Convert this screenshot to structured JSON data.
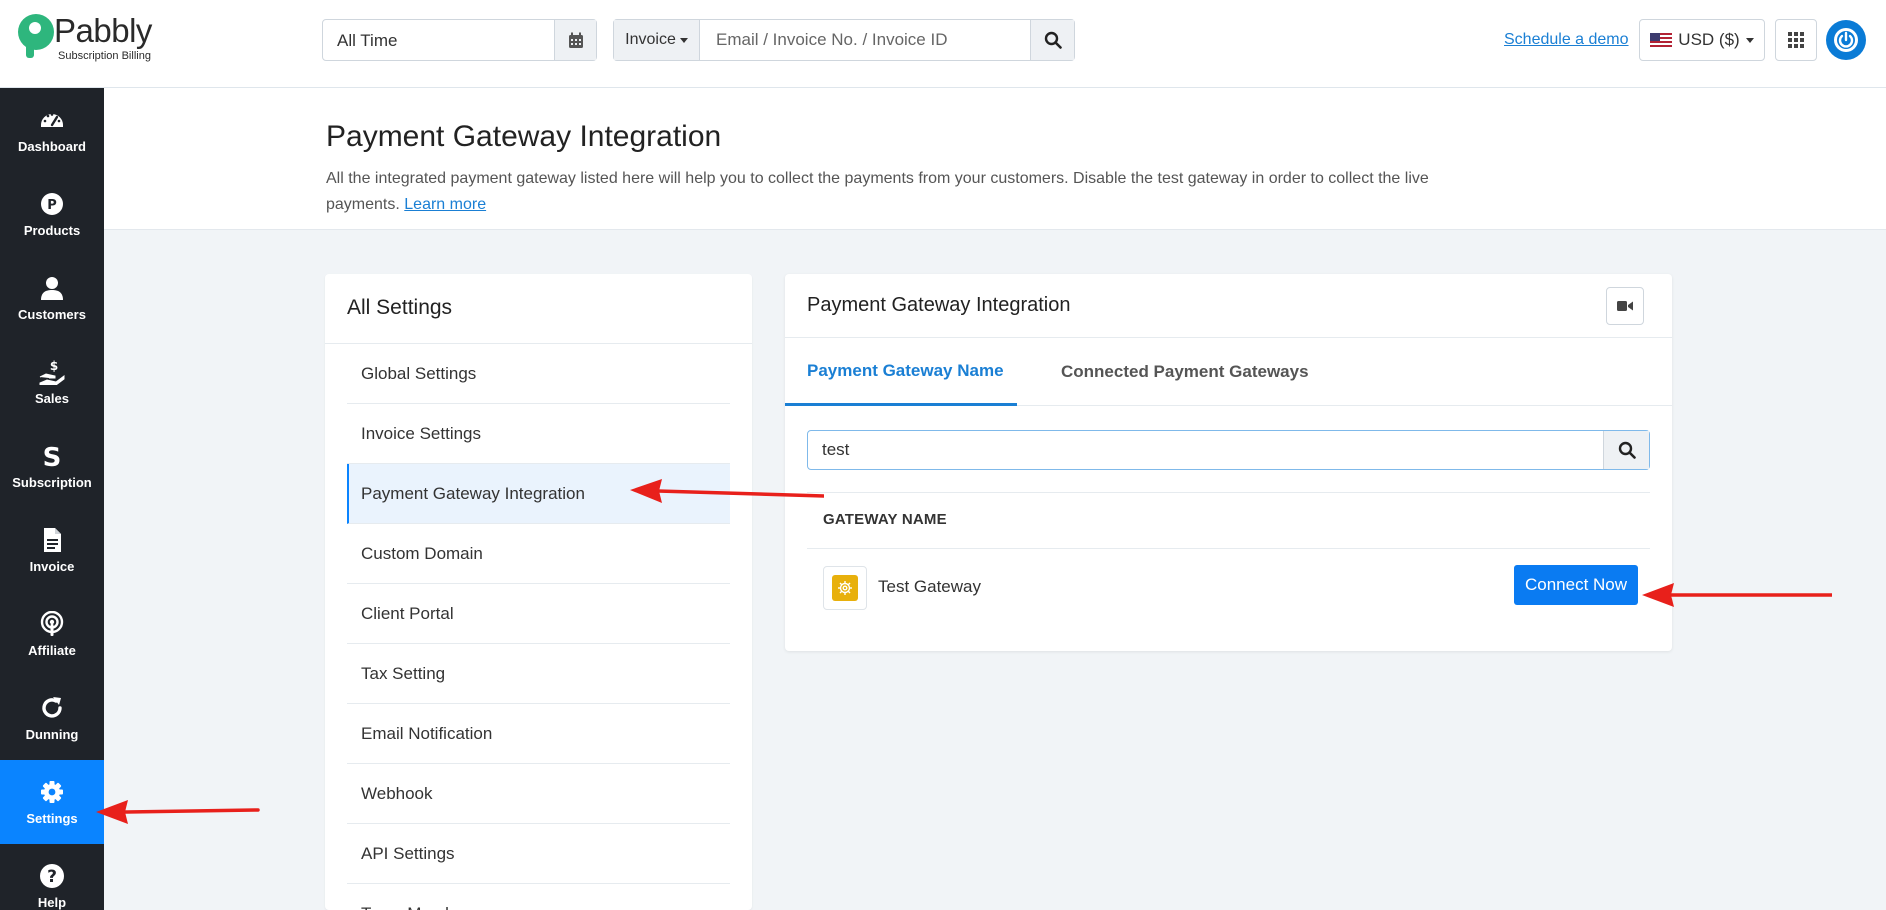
{
  "brand": {
    "name": "Pabbly",
    "subtitle": "Subscription Billing"
  },
  "topbar": {
    "date_filter": "All Time",
    "search_type": "Invoice",
    "search_placeholder": "Email / Invoice No. / Invoice ID",
    "demo_link": "Schedule a demo",
    "currency": "USD ($)"
  },
  "sidebar": {
    "items": [
      {
        "label": "Dashboard",
        "icon": "gauge-icon"
      },
      {
        "label": "Products",
        "icon": "products-p-icon"
      },
      {
        "label": "Customers",
        "icon": "user-icon"
      },
      {
        "label": "Sales",
        "icon": "hand-dollar-icon"
      },
      {
        "label": "Subscription",
        "icon": "subscription-s-icon"
      },
      {
        "label": "Invoice",
        "icon": "file-icon"
      },
      {
        "label": "Affiliate",
        "icon": "broadcast-icon"
      },
      {
        "label": "Dunning",
        "icon": "refresh-icon"
      },
      {
        "label": "Settings",
        "icon": "gear-icon",
        "active": true
      },
      {
        "label": "Help",
        "icon": "help-icon"
      }
    ]
  },
  "page": {
    "title": "Payment Gateway Integration",
    "description": "All the integrated payment gateway listed here will help you to collect the payments from your customers. Disable the test gateway in order to collect the live payments.",
    "learn_more": "Learn more"
  },
  "settings": {
    "title": "All Settings",
    "items": [
      "Global Settings",
      "Invoice Settings",
      "Payment Gateway Integration",
      "Custom Domain",
      "Client Portal",
      "Tax Setting",
      "Email Notification",
      "Webhook",
      "API Settings",
      "Team Members"
    ],
    "active_index": 2
  },
  "gateway": {
    "title": "Payment Gateway Integration",
    "tabs": [
      "Payment Gateway Name",
      "Connected Payment Gateways"
    ],
    "search_value": "test",
    "column_header": "GATEWAY NAME",
    "rows": [
      {
        "name": "Test Gateway",
        "action": "Connect Now"
      }
    ]
  },
  "colors": {
    "accent": "#0a84ff",
    "sidebar_bg": "#1f2329",
    "brand_green": "#2eb67d",
    "annotation_red": "#e8201b"
  }
}
